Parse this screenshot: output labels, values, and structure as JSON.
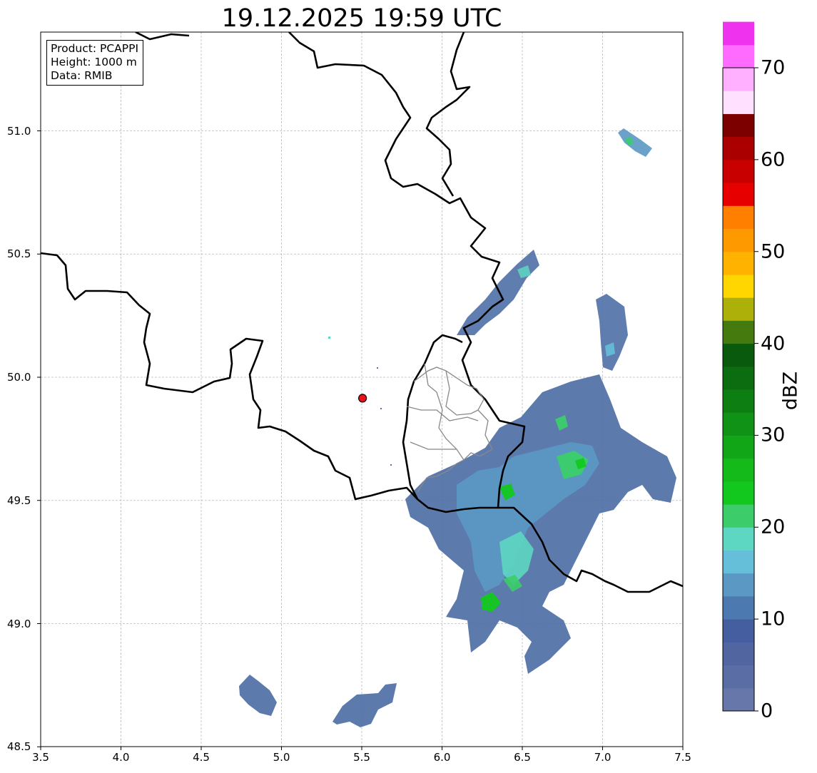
{
  "title": "19.12.2025 19:59 UTC",
  "info": {
    "product": "Product: PCAPPI",
    "height": "Height: 1000 m",
    "source": "Data: RMIB"
  },
  "axes": {
    "x_ticks": [
      "3.5",
      "4.0",
      "4.5",
      "5.0",
      "5.5",
      "6.0",
      "6.5",
      "7.0",
      "7.5"
    ],
    "y_ticks": [
      "51.0",
      "50.5",
      "50.0",
      "49.5",
      "49.0",
      "48.5"
    ],
    "lon_range": [
      3.5,
      7.5
    ],
    "lat_range": [
      48.5,
      51.4
    ],
    "grid": true
  },
  "radar_site": {
    "lon": 5.505,
    "lat": 49.915,
    "marker_color": "#e8131a"
  },
  "colorbar": {
    "label": "dBZ",
    "ticks": [
      "0",
      "10",
      "20",
      "30",
      "40",
      "50",
      "60",
      "70"
    ],
    "range": [
      0,
      70
    ],
    "step": 2.5,
    "colors": [
      "#6877a9",
      "#5a6ea5",
      "#5165a0",
      "#445ea0",
      "#4b79b0",
      "#5b98c4",
      "#66bfd8",
      "#5dd6c2",
      "#3ccd6a",
      "#12c81e",
      "#14b91a",
      "#11a617",
      "#0f9215",
      "#0c7e12",
      "#0b6d10",
      "#0a5a0d",
      "#457a0e",
      "#acb008",
      "#ffd600",
      "#ffb200",
      "#ff9900",
      "#ff7f00",
      "#e60000",
      "#c80000",
      "#aa0000",
      "#7d0000",
      "#ffe0ff",
      "#ffb0ff",
      "#ff6bff",
      "#ee32ee"
    ]
  }
}
